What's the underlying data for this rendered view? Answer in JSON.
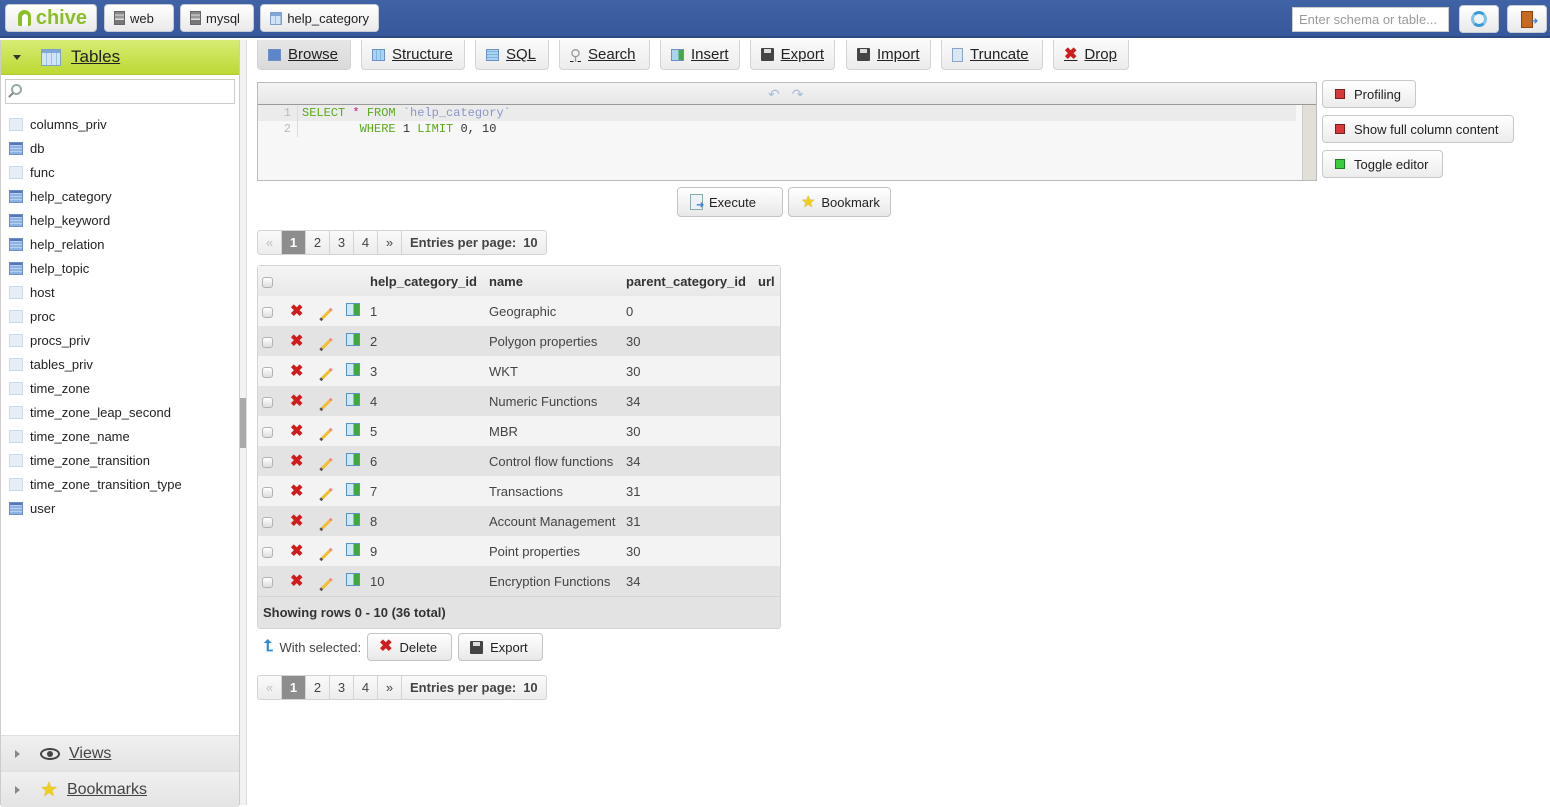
{
  "topbar": {
    "logo": "chive",
    "breadcrumbs": [
      {
        "label": "web",
        "icon": "server-icon"
      },
      {
        "label": "mysql",
        "icon": "database-icon"
      },
      {
        "label": "help_category",
        "icon": "table-icon"
      }
    ],
    "search_placeholder": "Enter schema or table...",
    "refresh_icon": "refresh-icon",
    "logout_icon": "logout-icon"
  },
  "sidebar": {
    "section_title": "Tables",
    "search_placeholder": "",
    "tables": [
      {
        "name": "columns_priv",
        "has_data": false
      },
      {
        "name": "db",
        "has_data": true
      },
      {
        "name": "func",
        "has_data": false
      },
      {
        "name": "help_category",
        "has_data": true
      },
      {
        "name": "help_keyword",
        "has_data": true
      },
      {
        "name": "help_relation",
        "has_data": true
      },
      {
        "name": "help_topic",
        "has_data": true
      },
      {
        "name": "host",
        "has_data": false
      },
      {
        "name": "proc",
        "has_data": false
      },
      {
        "name": "procs_priv",
        "has_data": false
      },
      {
        "name": "tables_priv",
        "has_data": false
      },
      {
        "name": "time_zone",
        "has_data": false
      },
      {
        "name": "time_zone_leap_second",
        "has_data": false
      },
      {
        "name": "time_zone_name",
        "has_data": false
      },
      {
        "name": "time_zone_transition",
        "has_data": false
      },
      {
        "name": "time_zone_transition_type",
        "has_data": false
      },
      {
        "name": "user",
        "has_data": true
      }
    ],
    "views_label": "Views",
    "bookmarks_label": "Bookmarks"
  },
  "toolbar": {
    "tabs": [
      {
        "label": "Browse",
        "active": true
      },
      {
        "label": "Structure"
      },
      {
        "label": "SQL"
      },
      {
        "label": "Search"
      },
      {
        "label": "Insert"
      },
      {
        "label": "Export"
      },
      {
        "label": "Import"
      },
      {
        "label": "Truncate"
      },
      {
        "label": "Drop"
      }
    ]
  },
  "editor": {
    "line_numbers": [
      "1",
      "2"
    ],
    "line1": {
      "kw1": "SELECT",
      "op": "*",
      "kw2": "FROM",
      "table": "`help_category`"
    },
    "line2": {
      "kw1": "WHERE",
      "n1": "1",
      "kw2": "LIMIT",
      "rest": "0, 10"
    }
  },
  "options": {
    "profiling": "Profiling",
    "show_full": "Show full column content",
    "toggle_editor": "Toggle editor"
  },
  "actions": {
    "execute": "Execute",
    "bookmark": "Bookmark"
  },
  "pagination": {
    "prev": "«",
    "pages": [
      "1",
      "2",
      "3",
      "4"
    ],
    "current_page": "1",
    "next": "»",
    "entries_label": "Entries per page:",
    "entries_value": "10"
  },
  "grid": {
    "columns": [
      "help_category_id",
      "name",
      "parent_category_id",
      "url"
    ],
    "rows": [
      [
        "1",
        "Geographic",
        "0",
        ""
      ],
      [
        "2",
        "Polygon properties",
        "30",
        ""
      ],
      [
        "3",
        "WKT",
        "30",
        ""
      ],
      [
        "4",
        "Numeric Functions",
        "34",
        ""
      ],
      [
        "5",
        "MBR",
        "30",
        ""
      ],
      [
        "6",
        "Control flow functions",
        "34",
        ""
      ],
      [
        "7",
        "Transactions",
        "31",
        ""
      ],
      [
        "8",
        "Account Management",
        "31",
        ""
      ],
      [
        "9",
        "Point properties",
        "30",
        ""
      ],
      [
        "10",
        "Encryption Functions",
        "34",
        ""
      ]
    ],
    "footer": "Showing rows 0 - 10 (36 total)"
  },
  "with_selected": {
    "label": "With selected:",
    "delete": "Delete",
    "export": "Export"
  }
}
